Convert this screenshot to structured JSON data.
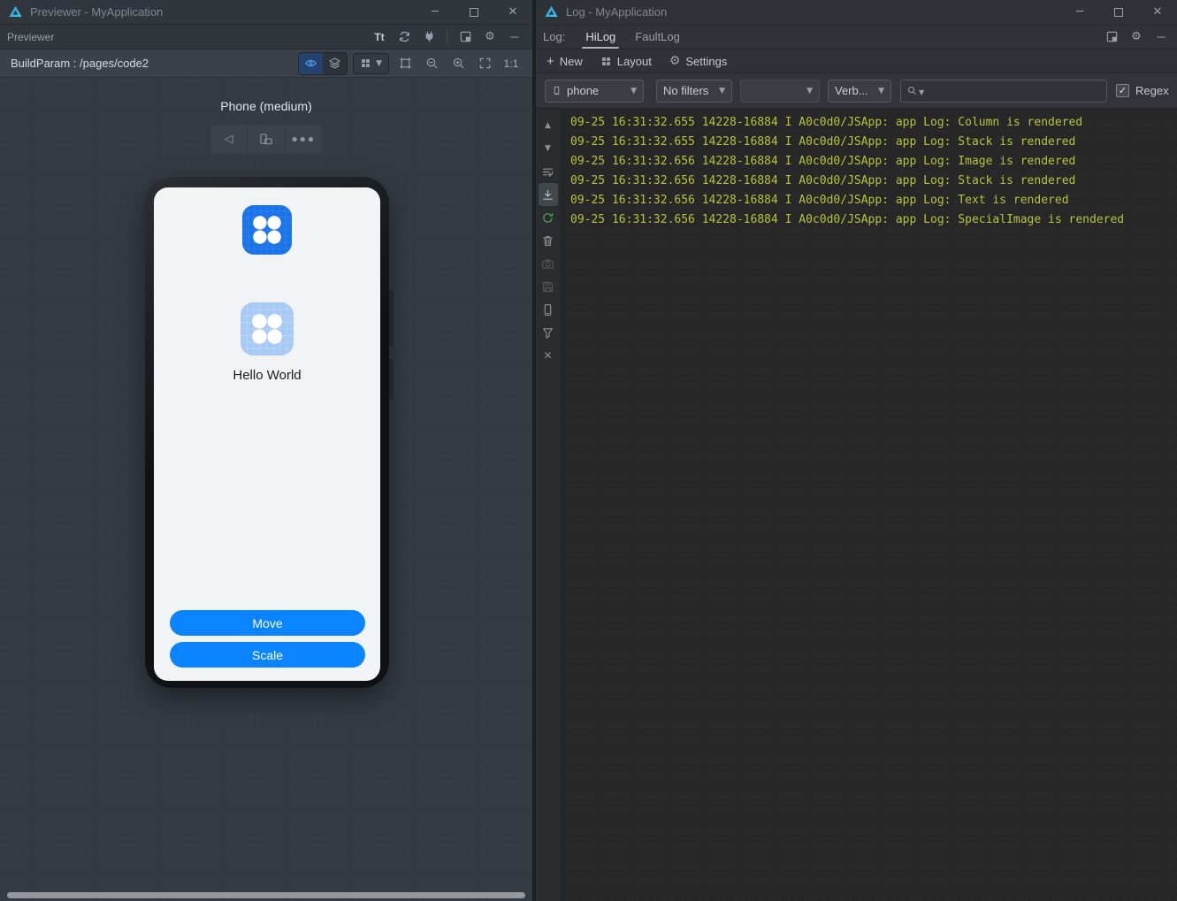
{
  "previewer": {
    "title": "Previewer - MyApplication",
    "panel_label": "Previewer",
    "build_param": "BuildParam : /pages/code2",
    "zoom_ratio_label": "1:1",
    "device_label": "Phone (medium)",
    "screen": {
      "hello_text": "Hello World",
      "buttons": [
        "Move",
        "Scale"
      ]
    },
    "colors": {
      "button_blue": "#0a85ff",
      "app_icon_blue": "#1a73e8",
      "app_icon_light": "#a6c9f5"
    }
  },
  "log": {
    "title": "Log - MyApplication",
    "tab_prefix": "Log:",
    "tabs": [
      {
        "label": "HiLog",
        "active": true
      },
      {
        "label": "FaultLog",
        "active": false
      }
    ],
    "toolbar": {
      "new_label": "New",
      "layout_label": "Layout",
      "settings_label": "Settings"
    },
    "filters": {
      "device_value": "phone",
      "filter_value": "No filters",
      "package_value": "",
      "level_value": "Verb...",
      "search_value": "",
      "regex_label": "Regex",
      "regex_checked": true
    },
    "gutter_icons": [
      {
        "name": "scroll-up-icon"
      },
      {
        "name": "scroll-down-icon"
      },
      {
        "name": "soft-wrap-icon"
      },
      {
        "name": "scroll-to-end-icon",
        "active": true
      },
      {
        "name": "rerun-icon",
        "variant": "green"
      },
      {
        "name": "clear-logs-icon"
      },
      {
        "name": "screenshot-icon",
        "disabled": true
      },
      {
        "name": "save-log-icon",
        "disabled": true
      },
      {
        "name": "device-screen-icon"
      },
      {
        "name": "filter-icon"
      },
      {
        "name": "close-icon"
      }
    ],
    "line_color": "#b9c23e",
    "lines": [
      {
        "time": "09-25 16:31:32.655",
        "pid": "14228-16884",
        "level": "I",
        "tag": "A0c0d0/JSApp:",
        "msg": "app Log: Column is rendered"
      },
      {
        "time": "09-25 16:31:32.655",
        "pid": "14228-16884",
        "level": "I",
        "tag": "A0c0d0/JSApp:",
        "msg": "app Log: Stack is rendered"
      },
      {
        "time": "09-25 16:31:32.656",
        "pid": "14228-16884",
        "level": "I",
        "tag": "A0c0d0/JSApp:",
        "msg": "app Log: Image is rendered"
      },
      {
        "time": "09-25 16:31:32.656",
        "pid": "14228-16884",
        "level": "I",
        "tag": "A0c0d0/JSApp:",
        "msg": "app Log: Stack is rendered"
      },
      {
        "time": "09-25 16:31:32.656",
        "pid": "14228-16884",
        "level": "I",
        "tag": "A0c0d0/JSApp:",
        "msg": "app Log: Text is rendered"
      },
      {
        "time": "09-25 16:31:32.656",
        "pid": "14228-16884",
        "level": "I",
        "tag": "A0c0d0/JSApp:",
        "msg": "app Log: SpecialImage is rendered"
      }
    ]
  }
}
